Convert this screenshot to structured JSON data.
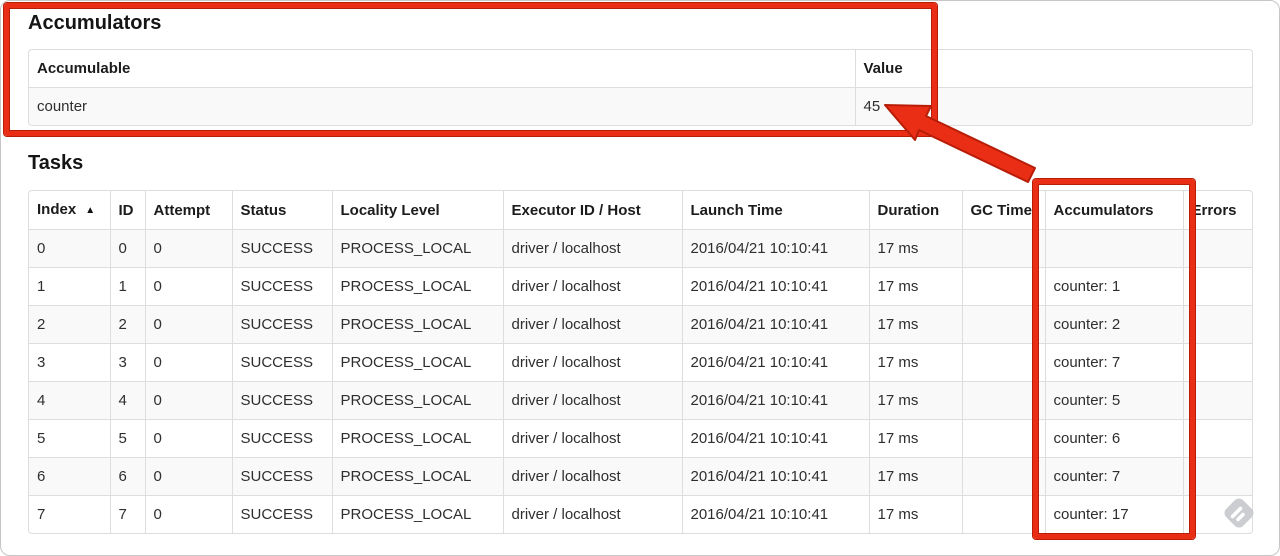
{
  "colors": {
    "annotation_red": "#ea2e16",
    "annotation_red_dark": "#b81d07",
    "table_border": "#dddddd",
    "row_stripe": "#f9f9f9"
  },
  "accumulators_section": {
    "heading": "Accumulators",
    "table": {
      "columns": [
        {
          "key": "name",
          "label": "Accumulable"
        },
        {
          "key": "value",
          "label": "Value"
        }
      ],
      "rows": [
        {
          "name": "counter",
          "value": "45"
        }
      ]
    }
  },
  "tasks_section": {
    "heading": "Tasks",
    "table": {
      "columns": [
        {
          "key": "index",
          "label": "Index",
          "sorted": true,
          "sort_icon": "▲"
        },
        {
          "key": "id",
          "label": "ID"
        },
        {
          "key": "attempt",
          "label": "Attempt"
        },
        {
          "key": "status",
          "label": "Status"
        },
        {
          "key": "locality",
          "label": "Locality Level"
        },
        {
          "key": "executor",
          "label": "Executor ID / Host"
        },
        {
          "key": "launch",
          "label": "Launch Time"
        },
        {
          "key": "duration",
          "label": "Duration"
        },
        {
          "key": "gc",
          "label": "GC Time"
        },
        {
          "key": "accumulators",
          "label": "Accumulators"
        },
        {
          "key": "errors",
          "label": "Errors"
        }
      ],
      "rows": [
        {
          "index": "0",
          "id": "0",
          "attempt": "0",
          "status": "SUCCESS",
          "locality": "PROCESS_LOCAL",
          "executor": "driver / localhost",
          "launch": "2016/04/21 10:10:41",
          "duration": "17 ms",
          "gc": "",
          "accumulators": "",
          "errors": ""
        },
        {
          "index": "1",
          "id": "1",
          "attempt": "0",
          "status": "SUCCESS",
          "locality": "PROCESS_LOCAL",
          "executor": "driver / localhost",
          "launch": "2016/04/21 10:10:41",
          "duration": "17 ms",
          "gc": "",
          "accumulators": "counter: 1",
          "errors": ""
        },
        {
          "index": "2",
          "id": "2",
          "attempt": "0",
          "status": "SUCCESS",
          "locality": "PROCESS_LOCAL",
          "executor": "driver / localhost",
          "launch": "2016/04/21 10:10:41",
          "duration": "17 ms",
          "gc": "",
          "accumulators": "counter: 2",
          "errors": ""
        },
        {
          "index": "3",
          "id": "3",
          "attempt": "0",
          "status": "SUCCESS",
          "locality": "PROCESS_LOCAL",
          "executor": "driver / localhost",
          "launch": "2016/04/21 10:10:41",
          "duration": "17 ms",
          "gc": "",
          "accumulators": "counter: 7",
          "errors": ""
        },
        {
          "index": "4",
          "id": "4",
          "attempt": "0",
          "status": "SUCCESS",
          "locality": "PROCESS_LOCAL",
          "executor": "driver / localhost",
          "launch": "2016/04/21 10:10:41",
          "duration": "17 ms",
          "gc": "",
          "accumulators": "counter: 5",
          "errors": ""
        },
        {
          "index": "5",
          "id": "5",
          "attempt": "0",
          "status": "SUCCESS",
          "locality": "PROCESS_LOCAL",
          "executor": "driver / localhost",
          "launch": "2016/04/21 10:10:41",
          "duration": "17 ms",
          "gc": "",
          "accumulators": "counter: 6",
          "errors": ""
        },
        {
          "index": "6",
          "id": "6",
          "attempt": "0",
          "status": "SUCCESS",
          "locality": "PROCESS_LOCAL",
          "executor": "driver / localhost",
          "launch": "2016/04/21 10:10:41",
          "duration": "17 ms",
          "gc": "",
          "accumulators": "counter: 7",
          "errors": ""
        },
        {
          "index": "7",
          "id": "7",
          "attempt": "0",
          "status": "SUCCESS",
          "locality": "PROCESS_LOCAL",
          "executor": "driver / localhost",
          "launch": "2016/04/21 10:10:41",
          "duration": "17 ms",
          "gc": "",
          "accumulators": "counter: 17",
          "errors": ""
        }
      ]
    }
  },
  "annotations": {
    "color": "#ea2e16",
    "items": [
      "box around accumulators section",
      "box around tasks accumulators column",
      "arrow from accumulators column to total value 45"
    ]
  },
  "watermark": {
    "icon": "feedly-logo"
  }
}
